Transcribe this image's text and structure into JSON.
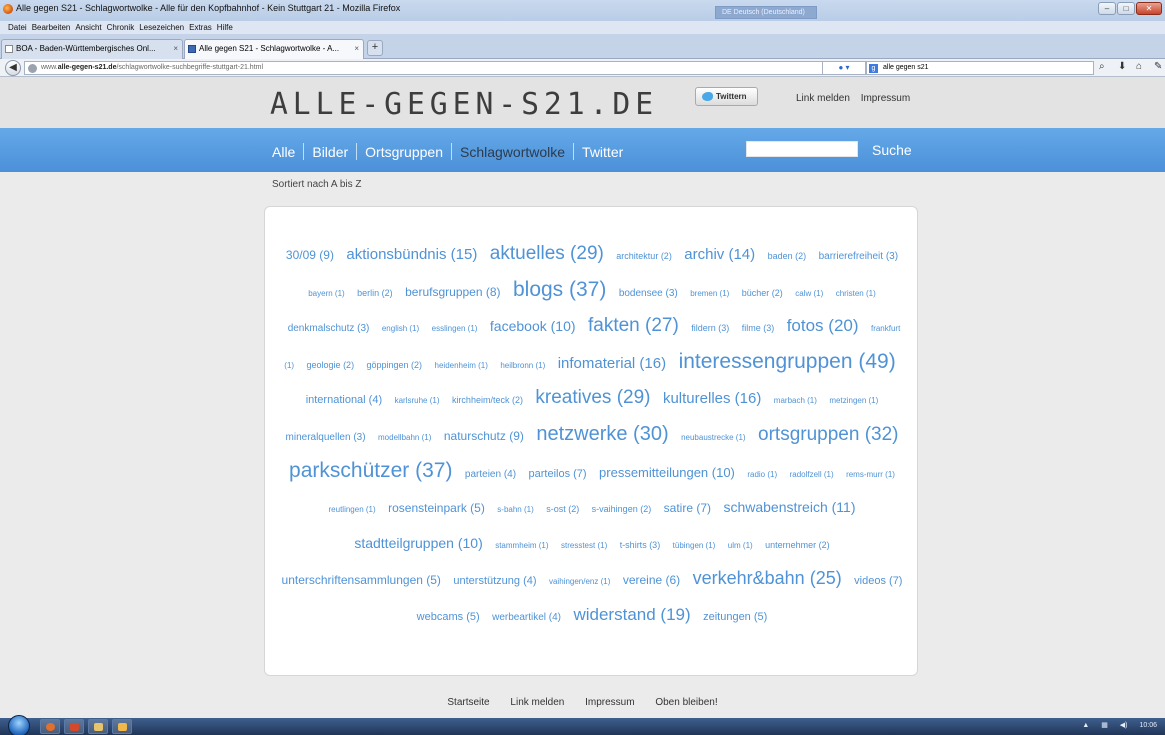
{
  "window": {
    "title": "Alle gegen S21 - Schlagwortwolke - Alle für den Kopfbahnhof - Kein Stuttgart 21 - Mozilla Firefox",
    "language_indicator": "DE Deutsch (Deutschland)"
  },
  "menubar": [
    "Datei",
    "Bearbeiten",
    "Ansicht",
    "Chronik",
    "Lesezeichen",
    "Extras",
    "Hilfe"
  ],
  "tabs": [
    {
      "label": "BOA - Baden-Württembergisches Onl..."
    },
    {
      "label": "Alle gegen S21 - Schlagwortwolke - A..."
    }
  ],
  "url": {
    "prefix": "www.",
    "host": "alle-gegen-s21.de",
    "path": "/schlagwortwolke-suchbegriffe-stuttgart-21.html"
  },
  "searchbar": {
    "value": "alle gegen s21"
  },
  "header": {
    "logo": "ALLE-GEGEN-S21.DE",
    "twitter_button": "Twittern",
    "links": [
      "Link melden",
      "Impressum"
    ]
  },
  "nav": {
    "items": [
      "Alle",
      "Bilder",
      "Ortsgruppen",
      "Schlagwortwolke",
      "Twitter"
    ],
    "active": "Schlagwortwolke",
    "search_button": "Suche"
  },
  "subline": "Sortiert nach A bis Z",
  "tags": [
    {
      "text": "30/09 (9)",
      "size": 12
    },
    {
      "text": "aktionsbündnis (15)",
      "size": 15
    },
    {
      "text": "aktuelles (29)",
      "size": 19
    },
    {
      "text": "architektur (2)",
      "size": 9
    },
    {
      "text": "archiv (14)",
      "size": 15
    },
    {
      "text": "baden (2)",
      "size": 9
    },
    {
      "text": "barrierefreiheit (3)",
      "size": 10
    },
    {
      "text": "bayern (1)",
      "size": 8
    },
    {
      "text": "berlin (2)",
      "size": 9
    },
    {
      "text": "berufsgruppen (8)",
      "size": 12
    },
    {
      "text": "blogs (37)",
      "size": 21
    },
    {
      "text": "bodensee (3)",
      "size": 10
    },
    {
      "text": "bremen (1)",
      "size": 8
    },
    {
      "text": "bücher (2)",
      "size": 9
    },
    {
      "text": "calw (1)",
      "size": 8
    },
    {
      "text": "christen (1)",
      "size": 8
    },
    {
      "text": "denkmalschutz (3)",
      "size": 10
    },
    {
      "text": "english (1)",
      "size": 8
    },
    {
      "text": "esslingen (1)",
      "size": 8
    },
    {
      "text": "facebook (10)",
      "size": 14
    },
    {
      "text": "fakten (27)",
      "size": 19
    },
    {
      "text": "fildern (3)",
      "size": 9
    },
    {
      "text": "filme (3)",
      "size": 9
    },
    {
      "text": "fotos (20)",
      "size": 17
    },
    {
      "text": "frankfurt (1)",
      "size": 8
    },
    {
      "text": "geologie (2)",
      "size": 9
    },
    {
      "text": "göppingen (2)",
      "size": 9
    },
    {
      "text": "heidenheim (1)",
      "size": 8
    },
    {
      "text": "heilbronn (1)",
      "size": 8
    },
    {
      "text": "infomaterial (16)",
      "size": 15
    },
    {
      "text": "interessengruppen (49)",
      "size": 21
    },
    {
      "text": "international (4)",
      "size": 11
    },
    {
      "text": "karlsruhe (1)",
      "size": 8
    },
    {
      "text": "kirchheim/teck (2)",
      "size": 9
    },
    {
      "text": "kreatives (29)",
      "size": 19
    },
    {
      "text": "kulturelles (16)",
      "size": 15
    },
    {
      "text": "marbach (1)",
      "size": 8
    },
    {
      "text": "metzingen (1)",
      "size": 8
    },
    {
      "text": "mineralquellen (3)",
      "size": 10
    },
    {
      "text": "modellbahn (1)",
      "size": 8
    },
    {
      "text": "naturschutz (9)",
      "size": 12
    },
    {
      "text": "netzwerke (30)",
      "size": 20
    },
    {
      "text": "neubaustrecke (1)",
      "size": 8
    },
    {
      "text": "ortsgruppen (32)",
      "size": 19
    },
    {
      "text": "parkschützer (37)",
      "size": 21
    },
    {
      "text": "parteien (4)",
      "size": 10
    },
    {
      "text": "parteilos (7)",
      "size": 11
    },
    {
      "text": "pressemitteilungen (10)",
      "size": 13
    },
    {
      "text": "radio (1)",
      "size": 8
    },
    {
      "text": "radolfzell (1)",
      "size": 8
    },
    {
      "text": "rems-murr (1)",
      "size": 8
    },
    {
      "text": "reutlingen (1)",
      "size": 8
    },
    {
      "text": "rosensteinpark (5)",
      "size": 12
    },
    {
      "text": "s-bahn (1)",
      "size": 8
    },
    {
      "text": "s-ost (2)",
      "size": 9
    },
    {
      "text": "s-vaihingen (2)",
      "size": 9
    },
    {
      "text": "satire (7)",
      "size": 12
    },
    {
      "text": "schwabenstreich (11)",
      "size": 14
    },
    {
      "text": "stadtteilgruppen (10)",
      "size": 14
    },
    {
      "text": "stammheim (1)",
      "size": 8
    },
    {
      "text": "stresstest (1)",
      "size": 8
    },
    {
      "text": "t-shirts (3)",
      "size": 9
    },
    {
      "text": "tübingen (1)",
      "size": 8
    },
    {
      "text": "ulm (1)",
      "size": 8
    },
    {
      "text": "unternehmer (2)",
      "size": 9
    },
    {
      "text": "unterschriftensammlungen (5)",
      "size": 12
    },
    {
      "text": "unterstützung (4)",
      "size": 11
    },
    {
      "text": "vaihingen/enz (1)",
      "size": 8
    },
    {
      "text": "vereine (6)",
      "size": 12
    },
    {
      "text": "verkehr&bahn (25)",
      "size": 18
    },
    {
      "text": "videos (7)",
      "size": 11
    },
    {
      "text": "webcams (5)",
      "size": 11
    },
    {
      "text": "werbeartikel (4)",
      "size": 10
    },
    {
      "text": "widerstand (19)",
      "size": 17
    },
    {
      "text": "zeitungen (5)",
      "size": 11
    }
  ],
  "footer": [
    "Startseite",
    "Link melden",
    "Impressum",
    "Oben bleiben!"
  ],
  "taskbar": {
    "clock": "10:06"
  },
  "colors": {
    "tag": "#4f93d6",
    "nav_top": "#65a9e8",
    "nav_bottom": "#4b90d9"
  }
}
